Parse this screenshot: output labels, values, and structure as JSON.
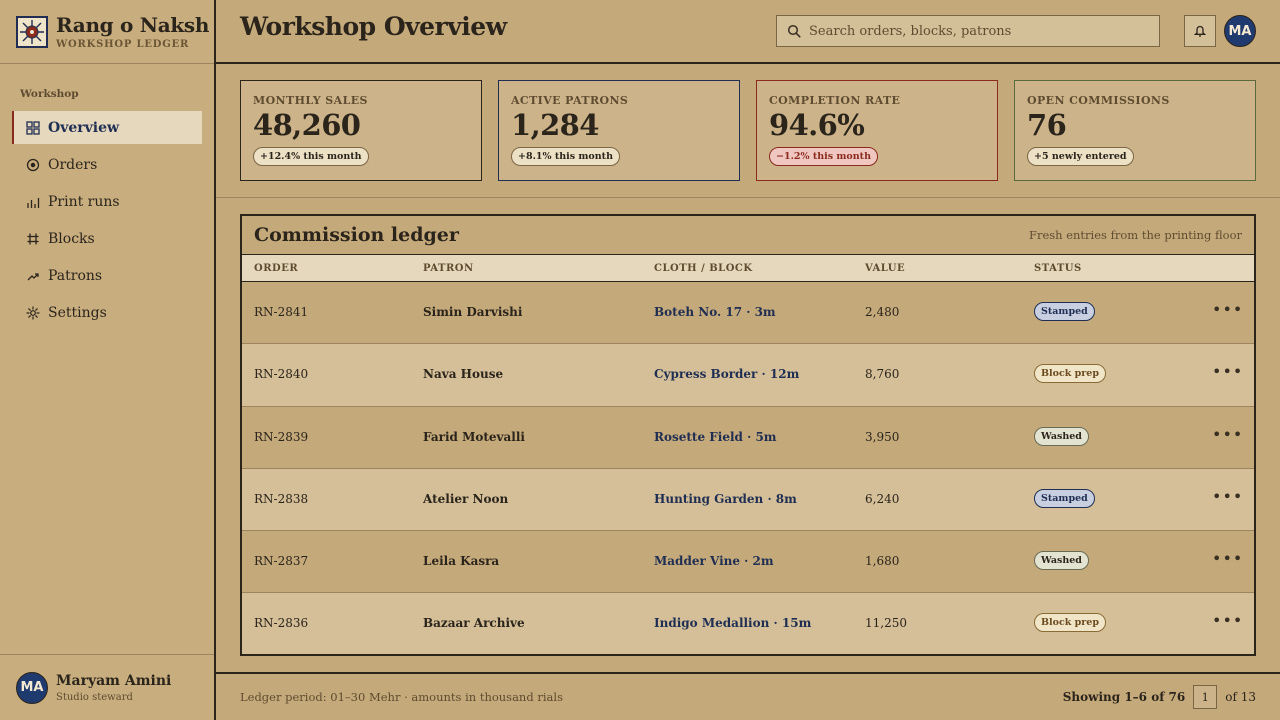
{
  "app": {
    "name": "Rang o Naksh",
    "subtitle": "WORKSHOP LEDGER",
    "logo_icon": "block-print-emblem-icon"
  },
  "sidebar": {
    "section_label": "Workshop",
    "items": [
      {
        "label": "Overview",
        "icon": "grid-icon",
        "active": true
      },
      {
        "label": "Orders",
        "icon": "target-icon",
        "active": false
      },
      {
        "label": "Print runs",
        "icon": "bar-chart-icon",
        "active": false
      },
      {
        "label": "Blocks",
        "icon": "hash-icon",
        "active": false
      },
      {
        "label": "Patrons",
        "icon": "trend-icon",
        "active": false
      },
      {
        "label": "Settings",
        "icon": "gear-icon",
        "active": false
      }
    ],
    "user": {
      "initials": "MA",
      "name": "Maryam Amini",
      "role": "Studio steward"
    }
  },
  "header": {
    "title": "Workshop Overview",
    "search_placeholder": "Search orders, blocks, patrons",
    "search_value": "",
    "avatar_initials": "MA"
  },
  "stats": [
    {
      "label": "MONTHLY SALES",
      "value": "48,260",
      "delta": "+12.4% this month",
      "trend": "up",
      "accent": "#2b241b"
    },
    {
      "label": "ACTIVE PATRONS",
      "value": "1,284",
      "delta": "+8.1% this month",
      "trend": "up",
      "accent": "#1f2e52"
    },
    {
      "label": "COMPLETION RATE",
      "value": "94.6%",
      "delta": "−1.2% this month",
      "trend": "down",
      "accent": "#8a2a1e"
    },
    {
      "label": "OPEN COMMISSIONS",
      "value": "76",
      "delta": "+5 newly entered",
      "trend": "up",
      "accent": "#5a6a3a"
    }
  ],
  "ledger": {
    "title": "Commission ledger",
    "subtitle": "Fresh entries from the printing floor",
    "columns": [
      "ORDER",
      "PATRON",
      "CLOTH / BLOCK",
      "VALUE",
      "STATUS"
    ],
    "rows": [
      {
        "order": "RN-2841",
        "patron": "Simin Darvishi",
        "cloth": "Boteh No. 17 · 3m",
        "value": "2,480",
        "status": "Stamped",
        "status_key": "stamped"
      },
      {
        "order": "RN-2840",
        "patron": "Nava House",
        "cloth": "Cypress Border · 12m",
        "value": "8,760",
        "status": "Block prep",
        "status_key": "blockprep"
      },
      {
        "order": "RN-2839",
        "patron": "Farid Motevalli",
        "cloth": "Rosette Field · 5m",
        "value": "3,950",
        "status": "Washed",
        "status_key": "washed"
      },
      {
        "order": "RN-2838",
        "patron": "Atelier Noon",
        "cloth": "Hunting Garden · 8m",
        "value": "6,240",
        "status": "Stamped",
        "status_key": "stamped"
      },
      {
        "order": "RN-2837",
        "patron": "Leila Kasra",
        "cloth": "Madder Vine · 2m",
        "value": "1,680",
        "status": "Washed",
        "status_key": "washed"
      },
      {
        "order": "RN-2836",
        "patron": "Bazaar Archive",
        "cloth": "Indigo Medallion · 15m",
        "value": "11,250",
        "status": "Block prep",
        "status_key": "blockprep"
      }
    ],
    "more_glyph": "•••"
  },
  "footer": {
    "note": "Ledger period: 01–30 Mehr · amounts in thousand rials",
    "showing": "Showing 1–6 of 76",
    "page": "1",
    "of_pages": "of 13"
  }
}
